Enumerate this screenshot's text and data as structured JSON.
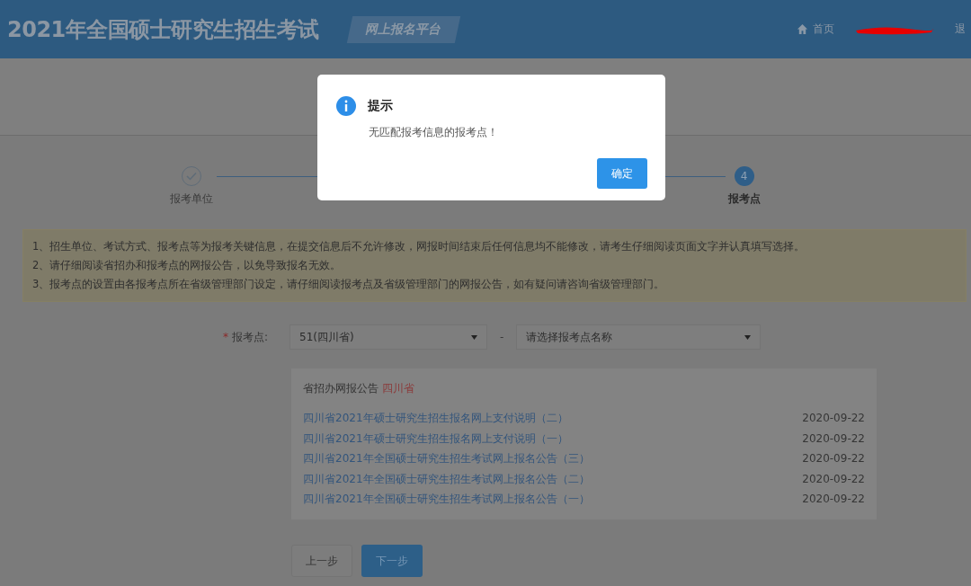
{
  "header": {
    "title": "2021年全国硕士研究生招生考试",
    "badge": "网上报名平台",
    "nav": [
      {
        "kind": "home",
        "label": "首页"
      },
      {
        "kind": "redacted"
      },
      {
        "kind": "plain",
        "label": "退"
      }
    ]
  },
  "steps": [
    {
      "label": "报考单位",
      "kind": "done"
    },
    {
      "label": "报考点",
      "number": "4",
      "kind": "current"
    }
  ],
  "notice": [
    "1、招生单位、考试方式、报考点等为报考关键信息，在提交信息后不允许修改，网报时间结束后任何信息均不能修改，请考生仔细阅读页面文字并认真填写选择。",
    "2、请仔细阅读省招办和报考点的网报公告，以免导致报名无效。",
    "3、报考点的设置由各报考点所在省级管理部门设定，请仔细阅读报考点及省级管理部门的网报公告，如有疑问请咨询省级管理部门。"
  ],
  "form": {
    "label": "报考点:",
    "required_mark": "*",
    "province": "51(四川省)",
    "separator": "-",
    "site_placeholder": "请选择报考点名称"
  },
  "announcements": {
    "heading": "省招办网报公告",
    "province": "四川省",
    "items": [
      {
        "title": "四川省2021年硕士研究生招生报名网上支付说明（二）",
        "date": "2020-09-22"
      },
      {
        "title": "四川省2021年硕士研究生招生报名网上支付说明（一）",
        "date": "2020-09-22"
      },
      {
        "title": "四川省2021年全国硕士研究生招生考试网上报名公告（三）",
        "date": "2020-09-22"
      },
      {
        "title": "四川省2021年全国硕士研究生招生考试网上报名公告（二）",
        "date": "2020-09-22"
      },
      {
        "title": "四川省2021年全国硕士研究生招生考试网上报名公告（一）",
        "date": "2020-09-22"
      }
    ]
  },
  "buttons": [
    {
      "label": "上一步",
      "kind": "secondary"
    },
    {
      "label": "下一步",
      "kind": "primary"
    }
  ],
  "dialog": {
    "title": "提示",
    "message": "无匹配报考信息的报考点！",
    "button": "确定"
  }
}
